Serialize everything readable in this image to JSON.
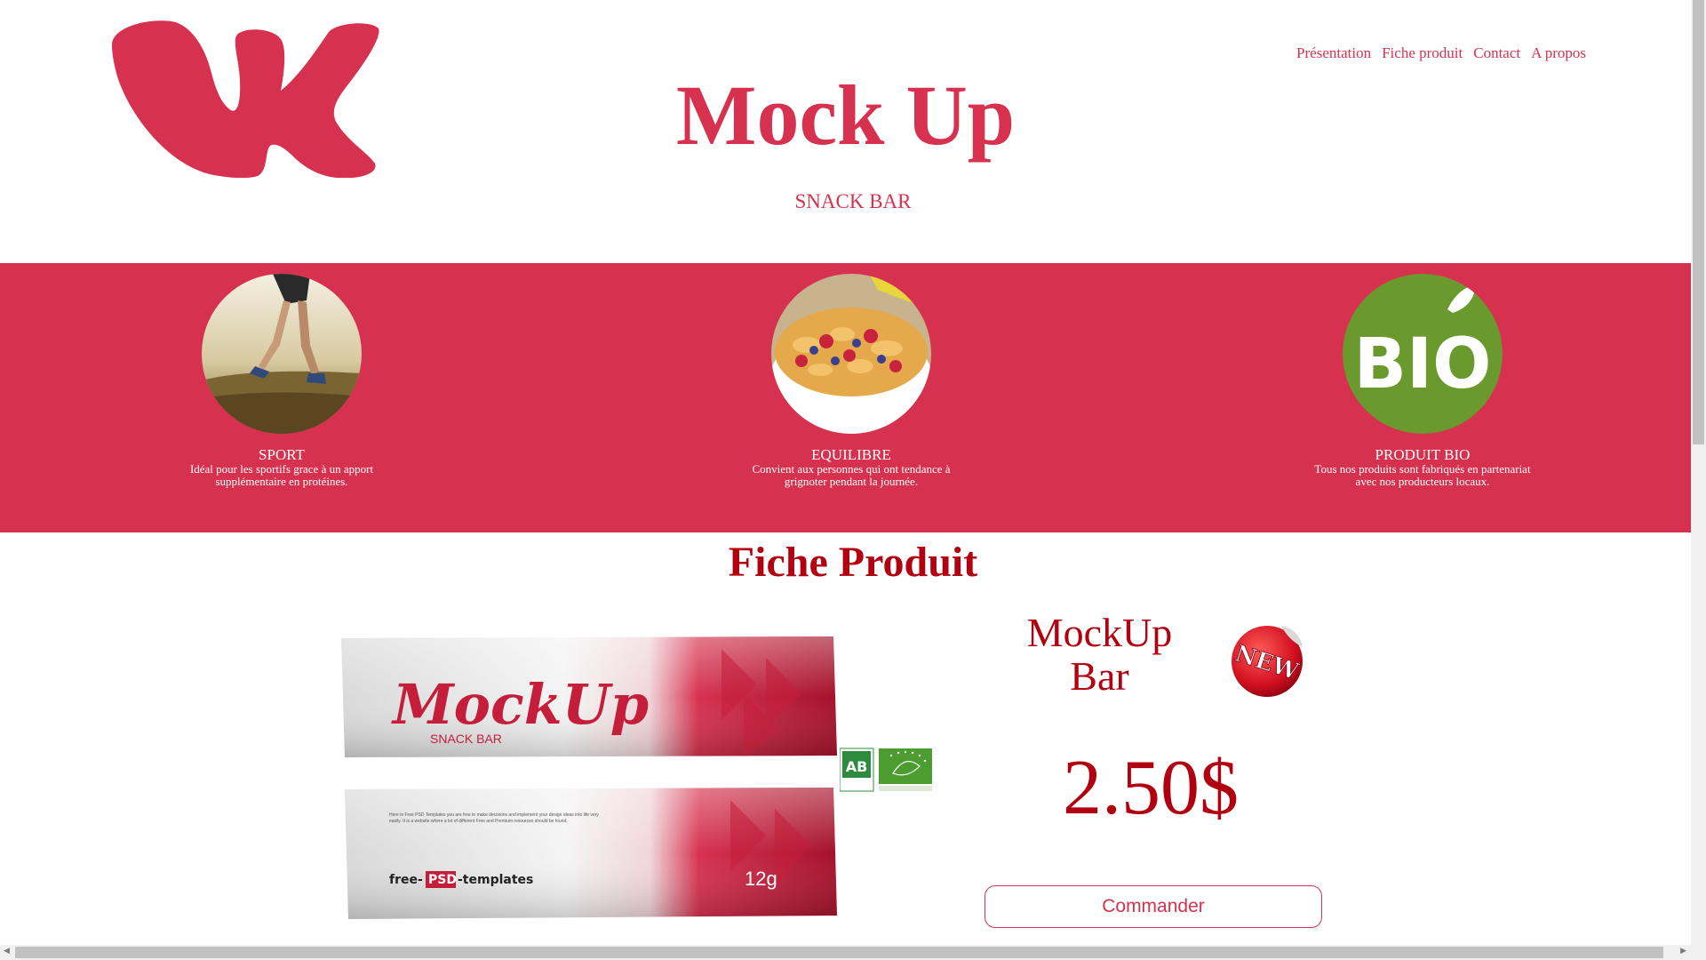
{
  "header": {
    "logo_icon": "vk-logo-icon",
    "title": "Mock Up",
    "subtitle": "SNACK BAR",
    "nav": [
      "Présentation",
      "Fiche produit",
      "Contact",
      "A propos"
    ]
  },
  "features": [
    {
      "icon": "runner-photo",
      "title": "SPORT",
      "text": "Idéal pour les sportifs grace à un apport supplémentaire en protéines."
    },
    {
      "icon": "cereal-bowl-photo",
      "title": "EQUILIBRE",
      "text": "Convient aux personnes qui ont tendance à grignoter pendant la journée."
    },
    {
      "icon": "bio-badge",
      "badge_text": "BIO",
      "title": "PRODUIT BIO",
      "text": "Tous nos produits sont fabriqués en partenariat avec nos producteurs locaux."
    }
  ],
  "product": {
    "section_title": "Fiche Produit",
    "name_line1": "MockUp",
    "name_line2": "Bar",
    "new_badge": "NEW",
    "price": "2.50$",
    "order_button": "Commander",
    "packaging": {
      "brand": "MockUp",
      "subtitle": "SNACK BAR",
      "weight": "12g",
      "small_text": "Here in Free PSD Templates you are free to make decisions and implement your design ideas into life very easily. It is a website where a lot of different Free and Premium resources should be found.",
      "watermark_left": "free-",
      "watermark_mid": "PSD",
      "watermark_right": "-templates"
    },
    "ab_label": "AB"
  },
  "colors": {
    "brand": "#d6324f",
    "dark_red": "#b1000f",
    "bio_green": "#6a9a2e"
  }
}
